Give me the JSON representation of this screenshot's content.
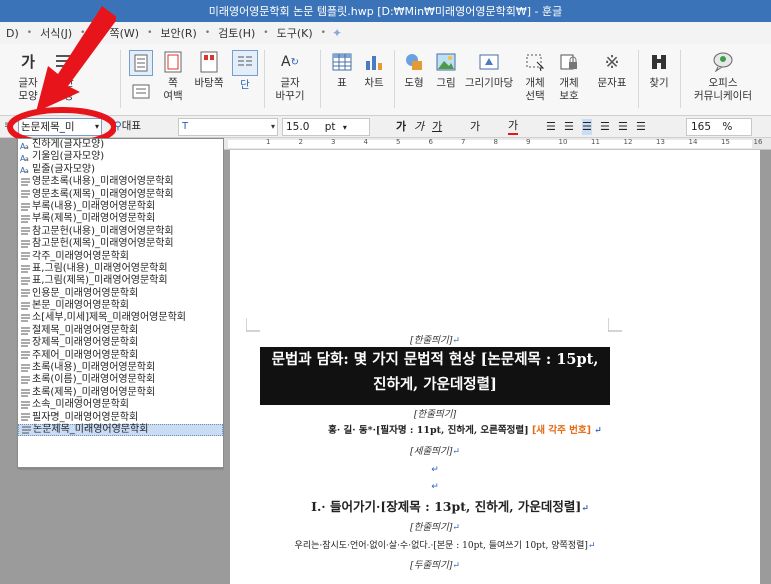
{
  "titlebar": {
    "text": "미래영어영문학회 논문 템플릿.hwp [D:₩Min₩미래영어영문학회₩] - 훈글"
  },
  "menubar": {
    "items": [
      "D)",
      "서식(J)",
      "쪽(W)",
      "보안(R)",
      "검토(H)",
      "도구(K)"
    ]
  },
  "ribbon": {
    "buttons": {
      "char_shape": [
        "글자",
        "모양"
      ],
      "para_shape": [
        "문단",
        "모양"
      ],
      "page_margin": [
        "쪽",
        "여백"
      ],
      "page_bg": "바탕쪽",
      "column": "단",
      "char_transform": [
        "글자",
        "바꾸기"
      ],
      "table": "표",
      "chart": "차트",
      "shape": "도형",
      "picture": "그림",
      "gallery": "그리기마당",
      "obj_select": [
        "개체",
        "선택"
      ],
      "obj_protect": [
        "개체",
        "보호"
      ],
      "char_map": "문자표",
      "find": "찾기",
      "office": [
        "오피스",
        "커뮤니케이터"
      ]
    }
  },
  "format": {
    "style": "논문제목_미",
    "face": "대표",
    "font": "T",
    "size": "15.0",
    "size_unit": "pt",
    "bold": "가",
    "italic": "가",
    "underline": "가",
    "strike": "가",
    "color": "가",
    "line_spacing": "165",
    "line_unit": "%"
  },
  "style_list": [
    "진하게(글자모양)",
    "기울임(글자모양)",
    "밑줄(글자모양)",
    "영문초록(내용)_미래영어영문학회",
    "영문초록(제목)_미래영어영문학회",
    "부록(내용)_미래영어영문학회",
    "부록(제목)_미래영어영문학회",
    "참고문헌(내용)_미래영어영문학회",
    "참고문헌(제목)_미래영어영문학회",
    "각주_미래영어영문학회",
    "표,그림(내용)_미래영어영문학회",
    "표,그림(제목)_미래영어영문학회",
    "인용문_미래영어영문학회",
    "본문_미래영어영문학회",
    "소[세부,미세]제목_미래영어영문학회",
    "절제목_미래영어영문학회",
    "장제목_미래영어영문학회",
    "주제어_미래영어영문학회",
    "초록(내용)_미래영어영문학회",
    "초록(이름)_미래영어영문학회",
    "초록(제목)_미래영어영문학회",
    "소속_미래영어영문학회",
    "필자명_미래영어영문학회",
    "논문제목_미래영어영문학회"
  ],
  "ruler": {
    "numbers": [
      "1",
      "2",
      "3",
      "4",
      "5",
      "6",
      "7",
      "8",
      "9",
      "10",
      "11",
      "12",
      "13",
      "14",
      "15",
      "16"
    ]
  },
  "document": {
    "note1": "[한줄띄기]",
    "title_line1": "문법과 담화: 몇 가지 문법적 현상 [논문제목 : 15pt,",
    "title_line2": "진하게, 가운데정렬]",
    "note2": "[한줄띄기]",
    "author": "홍· 길· 동*·[필자명 : 11pt, 진하게, 오른쪽정렬]",
    "author_note": "[새 각주 번호]",
    "note3": "[세줄띄기]",
    "chapter": "I.· 들어가기·[장제목 : 13pt, 진하게, 가운데정렬]",
    "note4": "[한줄띄기]",
    "body": "우리는·잠시도·언어·없이·살·수·없다.·[본문 : 10pt, 들여쓰기 10pt, 양쪽정렬]",
    "note5": "[두줄띄기]"
  },
  "colors": {
    "title_bar": "#3b73b9",
    "accent_red": "#e8141b",
    "selection": "#c9dcf3"
  }
}
